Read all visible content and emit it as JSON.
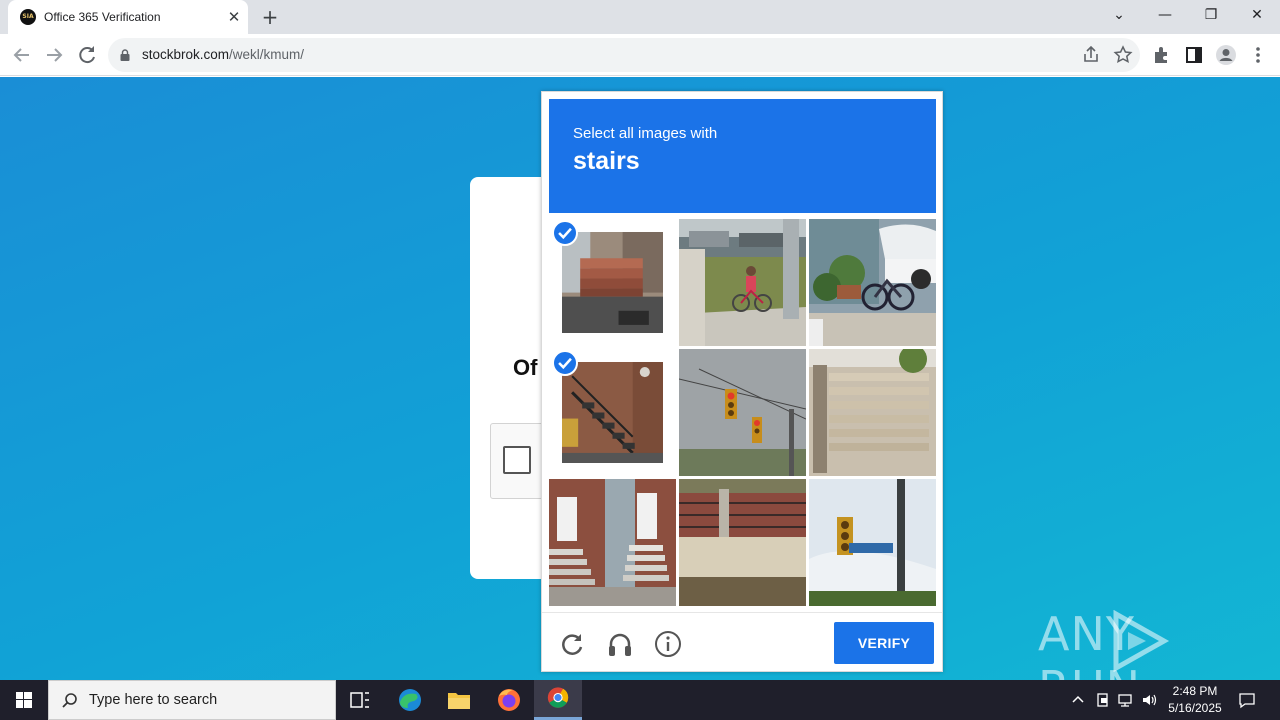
{
  "browser": {
    "tab_title": "Office 365 Verification",
    "favicon_text": "SIA",
    "close_glyph": "✕",
    "newtab_glyph": "+",
    "url_host": "stockbrok.com",
    "url_path": "/wekl/kmum/",
    "icons": [
      "back-icon",
      "forward-icon",
      "reload-icon",
      "lock-icon",
      "share-icon",
      "star-icon",
      "extensions-icon",
      "side-panel-icon",
      "profile-icon",
      "menu-icon"
    ],
    "window_controls": [
      "⌄",
      "—",
      "❐",
      "✕"
    ]
  },
  "page": {
    "login_heading": "Of",
    "watermark": "ANY RUN"
  },
  "challenge": {
    "prompt_line": "Select all images with",
    "prompt_target": "stairs",
    "accent": "#1b73e8",
    "tiles": [
      {
        "subject": "brick steps",
        "selected": true
      },
      {
        "subject": "child on bicycle",
        "selected": false
      },
      {
        "subject": "bicycle and plants",
        "selected": false
      },
      {
        "subject": "black metal stairs",
        "selected": true
      },
      {
        "subject": "traffic lights",
        "selected": false
      },
      {
        "subject": "wooden fence",
        "selected": false
      },
      {
        "subject": "brick house stairs",
        "selected": false
      },
      {
        "subject": "brick wall with fence",
        "selected": false
      },
      {
        "subject": "traffic light with street sign",
        "selected": false
      }
    ],
    "footer_icons": [
      "refresh-icon",
      "headphones-icon",
      "info-icon"
    ],
    "verify_label": "VERIFY"
  },
  "taskbar": {
    "search_placeholder": "Type here to search",
    "apps": [
      "task-view-icon",
      "edge-icon",
      "file-explorer-icon",
      "firefox-icon",
      "chrome-icon"
    ],
    "time": "2:48 PM",
    "date": "5/16/2025"
  }
}
